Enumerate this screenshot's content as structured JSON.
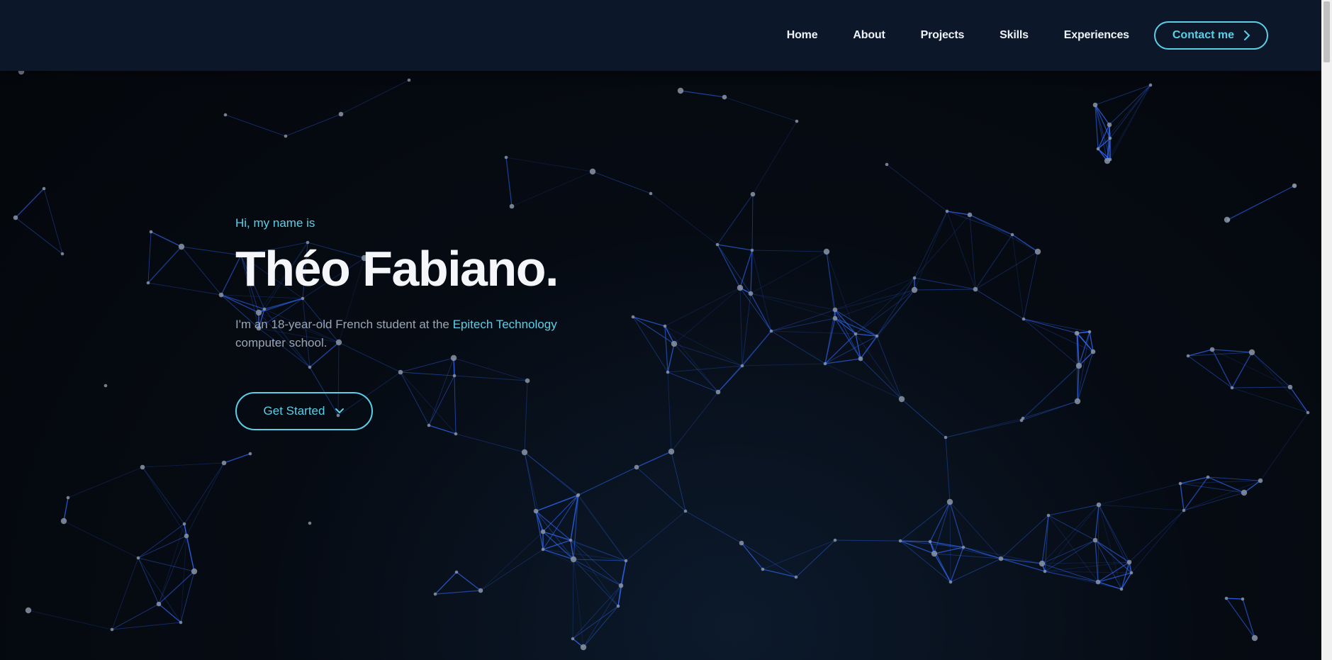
{
  "nav": {
    "items": [
      "Home",
      "About",
      "Projects",
      "Skills",
      "Experiences"
    ],
    "contact_label": "Contact me",
    "contact_icon": "chevron-right-icon"
  },
  "hero": {
    "greeting": "Hi, my name is",
    "name": "Théo Fabiano.",
    "description_start": "I'm an 18-year-old French student at the ",
    "description_accent": "Epitech Technology",
    "description_end": " computer school.",
    "cta_label": "Get Started",
    "cta_icon": "chevron-down-icon"
  },
  "colors": {
    "accent": "#5ccfe6",
    "header_bg": "#0c1829",
    "page_bg": "#05080d",
    "line": "#2f6bff",
    "node": "#8a94a3"
  }
}
